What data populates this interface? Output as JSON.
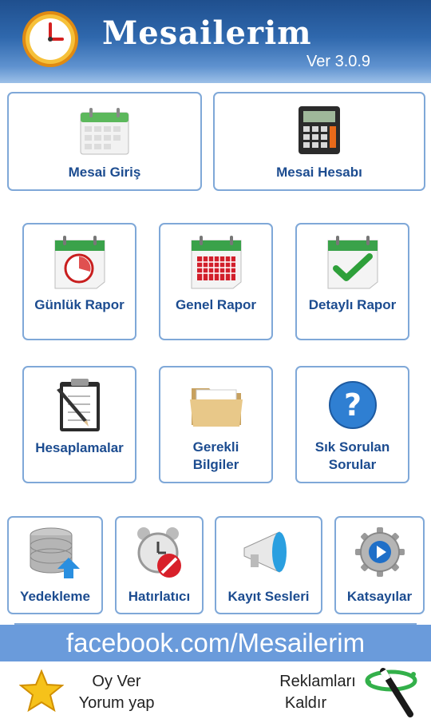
{
  "header": {
    "title": "Mesailerim",
    "version": "Ver 3.0.9"
  },
  "tiles_row1": [
    {
      "label": "Mesai Giriş",
      "icon": "calendar-icon"
    },
    {
      "label": "Mesai Hesabı",
      "icon": "calculator-icon"
    }
  ],
  "tiles_row2": [
    {
      "label": "Günlük Rapor",
      "icon": "daily-report-icon"
    },
    {
      "label": "Genel Rapor",
      "icon": "general-report-icon"
    },
    {
      "label": "Detaylı Rapor",
      "icon": "detailed-report-icon"
    }
  ],
  "tiles_row3": [
    {
      "label": "Hesaplamalar",
      "icon": "clipboard-icon"
    },
    {
      "label_line1": "Gerekli",
      "label_line2": "Bilgiler",
      "icon": "folder-icon"
    },
    {
      "label_line1": "Sık Sorulan",
      "label_line2": "Sorular",
      "icon": "question-icon"
    }
  ],
  "tiles_row4": [
    {
      "label": "Yedekleme",
      "icon": "database-backup-icon"
    },
    {
      "label": "Hatırlatıcı",
      "icon": "alarm-clock-icon"
    },
    {
      "label": "Kayıt Sesleri",
      "icon": "megaphone-icon"
    },
    {
      "label": "Katsayılar",
      "icon": "gear-icon"
    }
  ],
  "facebook": {
    "text": "facebook.com/Mesailerim"
  },
  "bottom": {
    "rate_line1": "Oy Ver",
    "rate_line2": "Yorum yap",
    "ads_line1": "Reklamları",
    "ads_line2": "Kaldır"
  },
  "colors": {
    "header_top": "#1f4f8e",
    "tile_border": "#7fa8d8",
    "label_blue": "#1c4c90",
    "facebook_bar": "#6a9bdb"
  }
}
